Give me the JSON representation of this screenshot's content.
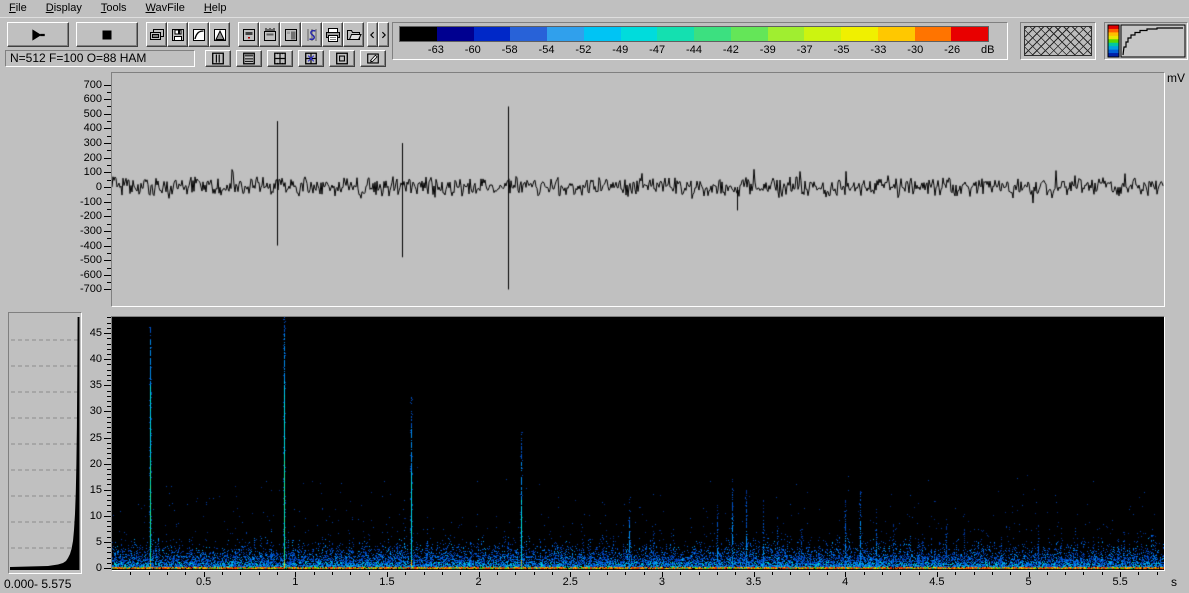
{
  "menu": {
    "items": [
      "File",
      "Display",
      "Tools",
      "WavFile",
      "Help"
    ]
  },
  "toolbar": {
    "status_text": "N=512 F=100 O=88 HAM",
    "row1_icons": [
      "play-icon",
      "stop-icon",
      "capture-window-icon",
      "save-icon",
      "scale-curve-icon",
      "peak-window-icon",
      "pane-trace-icon",
      "pane-ticks-icon",
      "pane-shaded-icon",
      "pane-signal-icon",
      "print-icon",
      "open-file-icon",
      "prev-icon",
      "next-icon"
    ],
    "row2_icons": [
      "grid-vertical-icon",
      "grid-horizontal-icon",
      "grid-quad-icon",
      "grid-quad-cross-icon",
      "inner-window-icon",
      "edit-pane-icon"
    ],
    "colorbar": {
      "unit": "dB",
      "tick_labels": [
        "-63",
        "-60",
        "-58",
        "-54",
        "-52",
        "-49",
        "-47",
        "-44",
        "-42",
        "-39",
        "-37",
        "-35",
        "-33",
        "-30",
        "-26"
      ],
      "segment_colors": [
        "#000000",
        "#000090",
        "#0028c8",
        "#2862d8",
        "#30a0ec",
        "#00c4f4",
        "#00dcdc",
        "#14e0b0",
        "#3ce080",
        "#64e658",
        "#a0ee30",
        "#ccf410",
        "#f0f000",
        "#ffc800",
        "#ff7400",
        "#e80000"
      ]
    },
    "palette_preview_colors": [
      "#e00000",
      "#ff6000",
      "#ffc000",
      "#e8e800",
      "#58d800",
      "#00c8a0",
      "#00a0e0",
      "#0060d8",
      "#0020a8"
    ]
  },
  "waveform_panel": {
    "unit_label": "mV"
  },
  "spectrogram_panel": {
    "unit_label": "s"
  },
  "histogram_panel": {
    "range_label": "0.000- 5.575"
  },
  "chart_data": [
    {
      "type": "line",
      "name": "waveform",
      "ylabel": "mV",
      "ylim": [
        -700,
        700
      ],
      "ytick_major": 100,
      "ytick_minor": 50,
      "x_range_s": [
        0,
        5.74
      ],
      "noise_amplitude_mv": 80,
      "spikes": [
        {
          "t": 0.9,
          "peak_mv": 450,
          "trough_mv": -400
        },
        {
          "t": 1.58,
          "peak_mv": 300,
          "trough_mv": -480
        },
        {
          "t": 2.16,
          "peak_mv": 550,
          "trough_mv": -700
        },
        {
          "t": 3.41,
          "peak_mv": 0,
          "trough_mv": -160
        }
      ]
    },
    {
      "type": "heatmap",
      "name": "spectrogram",
      "xlabel_unit": "s",
      "ylabel_implicit_khz": true,
      "y_range_khz": [
        0,
        48.5
      ],
      "ytick_major": 5,
      "ytick_minor": 1,
      "xtick_labels": [
        "0.5",
        "1",
        "1.5",
        "2",
        "2.5",
        "3",
        "3.5",
        "4",
        "4.5",
        "5",
        "5.5"
      ],
      "xtick_major_s": 0.5,
      "xtick_minor_s": 0.1,
      "noise_band_top_khz": 5,
      "events_format": [
        "time_s",
        "f_top_khz",
        "strength_0_to_1"
      ],
      "events": [
        [
          0.21,
          47.0,
          1.0
        ],
        [
          0.94,
          48.4,
          1.0
        ],
        [
          1.63,
          33.0,
          0.75
        ],
        [
          2.23,
          26.0,
          0.7
        ],
        [
          2.6,
          5.0,
          0.25
        ],
        [
          2.82,
          14.0,
          0.5
        ],
        [
          2.95,
          8.0,
          0.35
        ],
        [
          3.3,
          12.0,
          0.4
        ],
        [
          3.38,
          17.0,
          0.5
        ],
        [
          3.46,
          15.0,
          0.45
        ],
        [
          3.55,
          13.0,
          0.4
        ],
        [
          3.63,
          10.0,
          0.35
        ],
        [
          3.76,
          8.0,
          0.3
        ],
        [
          4.0,
          13.0,
          0.45
        ],
        [
          4.08,
          16.0,
          0.5
        ],
        [
          4.17,
          12.0,
          0.4
        ],
        [
          4.26,
          9.0,
          0.3
        ],
        [
          4.42,
          7.0,
          0.25
        ],
        [
          4.55,
          10.0,
          0.35
        ],
        [
          4.65,
          8.0,
          0.3
        ],
        [
          4.85,
          6.0,
          0.25
        ],
        [
          5.05,
          9.0,
          0.3
        ],
        [
          5.18,
          7.0,
          0.25
        ],
        [
          5.35,
          6.0,
          0.25
        ],
        [
          5.52,
          7.0,
          0.25
        ]
      ]
    }
  ]
}
